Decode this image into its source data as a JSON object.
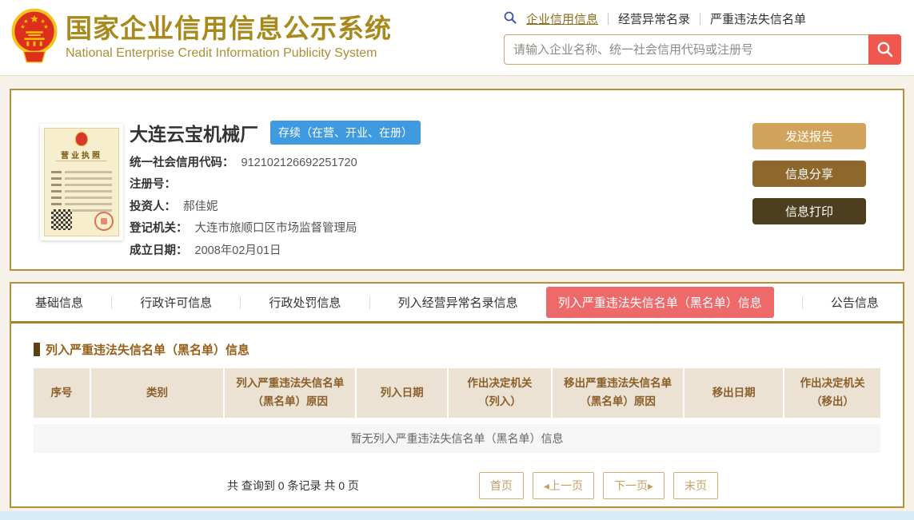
{
  "header": {
    "site_title": "国家企业信用信息公示系统",
    "site_subtitle": "National Enterprise Credit Information Publicity System",
    "nav": [
      {
        "label": "企业信用信息",
        "active": true
      },
      {
        "label": "经营异常名录",
        "active": false
      },
      {
        "label": "严重违法失信名单",
        "active": false
      }
    ],
    "search": {
      "placeholder": "请输入企业名称、统一社会信用代码或注册号"
    }
  },
  "company": {
    "name": "大连云宝机械厂",
    "status_badge": "存续（在营、开业、在册）",
    "license_title": "营业执照",
    "fields": [
      {
        "label": "统一社会信用代码：",
        "value": "912102126692251720"
      },
      {
        "label": "注册号：",
        "value": ""
      },
      {
        "label": "投资人：",
        "value": "郝佳妮"
      },
      {
        "label": "登记机关：",
        "value": "大连市旅顺口区市场监督管理局"
      },
      {
        "label": "成立日期：",
        "value": "2008年02月01日"
      }
    ],
    "actions": [
      {
        "label": "发送报告"
      },
      {
        "label": "信息分享"
      },
      {
        "label": "信息打印"
      }
    ]
  },
  "tabs": [
    {
      "label": "基础信息",
      "active": false
    },
    {
      "label": "行政许可信息",
      "active": false
    },
    {
      "label": "行政处罚信息",
      "active": false
    },
    {
      "label": "列入经营异常名录信息",
      "active": false
    },
    {
      "label": "列入严重违法失信名单（黑名单）信息",
      "active": true
    },
    {
      "label": "公告信息",
      "active": false
    }
  ],
  "content": {
    "section_title": "列入严重违法失信名单（黑名单）信息",
    "table_headers": [
      "序号",
      "类别",
      "列入严重违法失信名单（黑名单）原因",
      "列入日期",
      "作出决定机关（列入）",
      "移出严重违法失信名单（黑名单）原因",
      "移出日期",
      "作出决定机关（移出）"
    ],
    "empty_text": "暂无列入严重违法失信名单（黑名单）信息",
    "pagination": {
      "summary": "共 查询到 0 条记录 共 0 页",
      "first": "首页",
      "prev": "◂上一页",
      "next": "下一页▸",
      "last": "末页"
    }
  },
  "colors": {
    "brand_gold": "#a8891c",
    "card_border_gold": "#b5903a",
    "status_badge_blue": "#3f9ae0",
    "active_tab_red": "#ee6a6a",
    "search_button_red": "#ee584e",
    "table_header_bg": "#ebe2d3",
    "table_header_text": "#8a5f2a",
    "button_send_report": "#d2a35b",
    "button_share": "#8d672b",
    "button_print": "#4e3e20",
    "footer_blue": "#d8ecf7"
  }
}
